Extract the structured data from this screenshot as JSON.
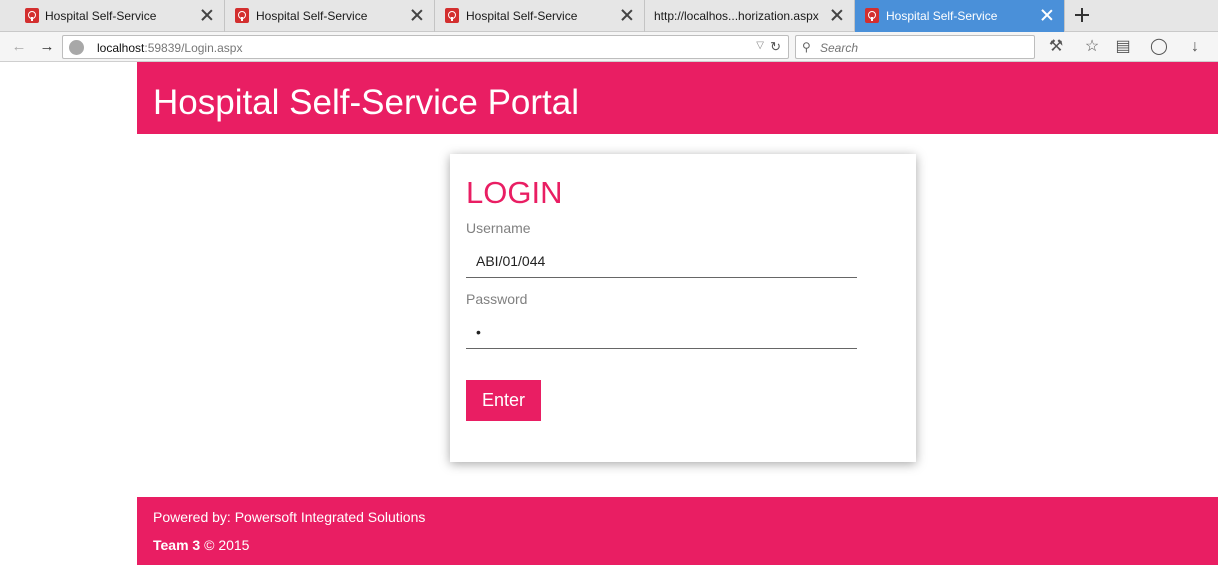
{
  "browser": {
    "tabs": [
      {
        "label": "Hospital Self-Service",
        "favicon": "hospital-icon",
        "active": false
      },
      {
        "label": "Hospital Self-Service",
        "favicon": "hospital-icon",
        "active": false
      },
      {
        "label": "Hospital Self-Service",
        "favicon": "hospital-icon",
        "active": false
      },
      {
        "label": "http://localhos...horization.aspx",
        "favicon": "",
        "active": false
      },
      {
        "label": "Hospital Self-Service",
        "favicon": "hospital-icon",
        "active": true
      }
    ],
    "url_host": "localhost",
    "url_rest": ":59839/Login.aspx",
    "search_placeholder": "Search",
    "active_tab_color": "#4a90d9"
  },
  "page": {
    "header_title": "Hospital Self-Service Portal",
    "brand_color": "#e91e63",
    "login": {
      "title": "LOGIN",
      "username_label": "Username",
      "username_value": "ABI/01/044",
      "password_label": "Password",
      "password_value": "x",
      "submit_label": "Enter"
    },
    "footer": {
      "powered_by": "Powered by: Powersoft Integrated Solutions",
      "team": "Team 3",
      "copyright": " © 2015"
    }
  }
}
